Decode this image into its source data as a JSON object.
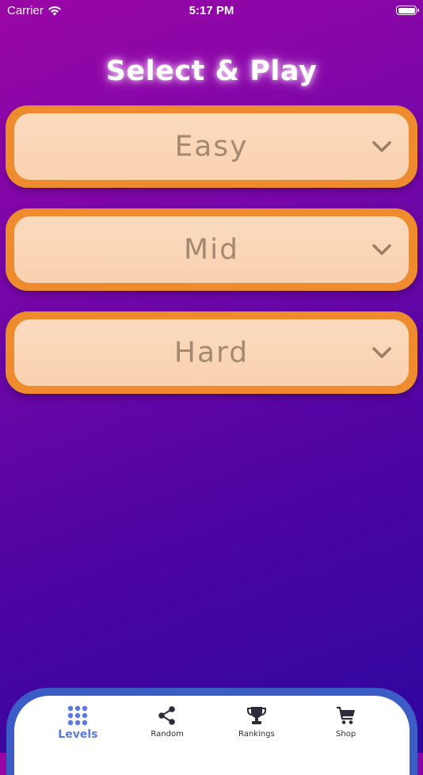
{
  "status_bar": {
    "carrier": "Carrier",
    "time": "5:17 PM"
  },
  "header": {
    "title": "Select & Play"
  },
  "levels": [
    {
      "label": "Easy"
    },
    {
      "label": "Mid"
    },
    {
      "label": "Hard"
    }
  ],
  "tab_bar": {
    "items": [
      {
        "label": "Levels",
        "icon": "grid-icon",
        "active": true
      },
      {
        "label": "Random",
        "icon": "share-icon",
        "active": false
      },
      {
        "label": "Rankings",
        "icon": "trophy-icon",
        "active": false
      },
      {
        "label": "Shop",
        "icon": "cart-icon",
        "active": false
      }
    ]
  },
  "colors": {
    "background_top": "#9a06a6",
    "background_bottom": "#2e069e",
    "select_border": "#ee8b2e",
    "select_fill": "#fbdabd",
    "select_text": "#a48870",
    "tab_bar_frame": "#3c5cc6",
    "tab_active": "#5a78e0"
  }
}
